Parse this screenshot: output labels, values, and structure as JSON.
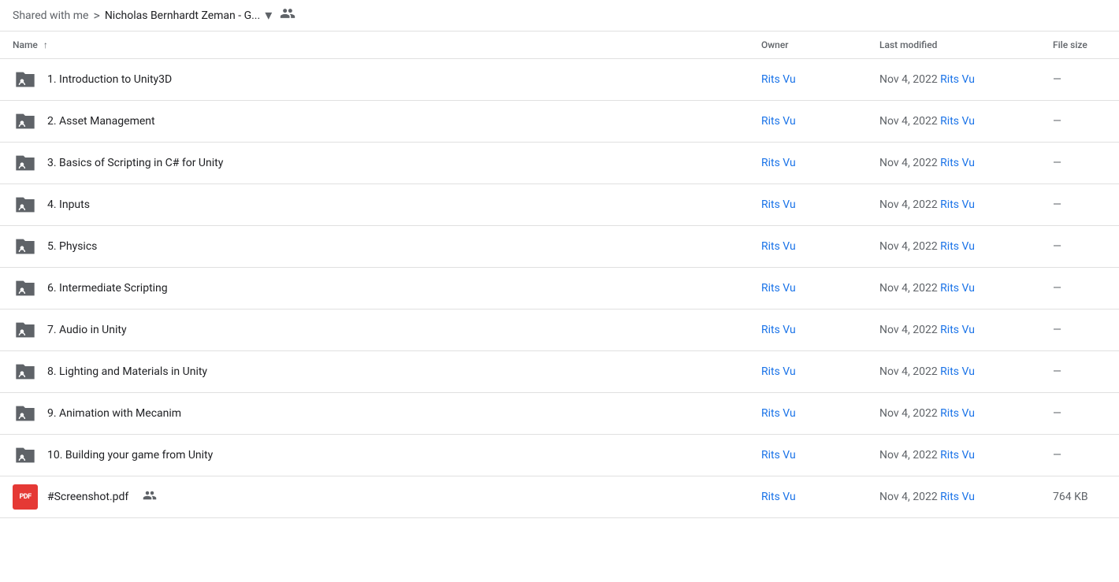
{
  "breadcrumb": {
    "shared_label": "Shared with me",
    "separator": ">",
    "current_folder": "Nicholas Bernhardt Zeman - G...",
    "dropdown_icon": "▾"
  },
  "table": {
    "columns": {
      "name": "Name",
      "sort_icon": "↑",
      "owner": "Owner",
      "last_modified": "Last modified",
      "file_size": "File size"
    },
    "rows": [
      {
        "type": "folder",
        "name": "1. Introduction to Unity3D",
        "owner": "Rits Vu",
        "modified": "Nov 4, 2022",
        "modified_by": "Rits Vu",
        "size": "—"
      },
      {
        "type": "folder",
        "name": "2. Asset Management",
        "owner": "Rits Vu",
        "modified": "Nov 4, 2022",
        "modified_by": "Rits Vu",
        "size": "—"
      },
      {
        "type": "folder",
        "name": "3. Basics of Scripting in C# for Unity",
        "owner": "Rits Vu",
        "modified": "Nov 4, 2022",
        "modified_by": "Rits Vu",
        "size": "—"
      },
      {
        "type": "folder",
        "name": "4. Inputs",
        "owner": "Rits Vu",
        "modified": "Nov 4, 2022",
        "modified_by": "Rits Vu",
        "size": "—"
      },
      {
        "type": "folder",
        "name": "5. Physics",
        "owner": "Rits Vu",
        "modified": "Nov 4, 2022",
        "modified_by": "Rits Vu",
        "size": "—"
      },
      {
        "type": "folder",
        "name": "6. Intermediate Scripting",
        "owner": "Rits Vu",
        "modified": "Nov 4, 2022",
        "modified_by": "Rits Vu",
        "size": "—"
      },
      {
        "type": "folder",
        "name": "7. Audio in Unity",
        "owner": "Rits Vu",
        "modified": "Nov 4, 2022",
        "modified_by": "Rits Vu",
        "size": "—"
      },
      {
        "type": "folder",
        "name": "8. Lighting and Materials in Unity",
        "owner": "Rits Vu",
        "modified": "Nov 4, 2022",
        "modified_by": "Rits Vu",
        "size": "—"
      },
      {
        "type": "folder",
        "name": "9. Animation with Mecanim",
        "owner": "Rits Vu",
        "modified": "Nov 4, 2022",
        "modified_by": "Rits Vu",
        "size": "—"
      },
      {
        "type": "folder",
        "name": "10. Building your game from Unity",
        "owner": "Rits Vu",
        "modified": "Nov 4, 2022",
        "modified_by": "Rits Vu",
        "size": "—"
      },
      {
        "type": "pdf",
        "name": "#Screenshot.pdf",
        "shared": true,
        "owner": "Rits Vu",
        "modified": "Nov 4, 2022",
        "modified_by": "Rits Vu",
        "size": "764 KB"
      }
    ]
  }
}
